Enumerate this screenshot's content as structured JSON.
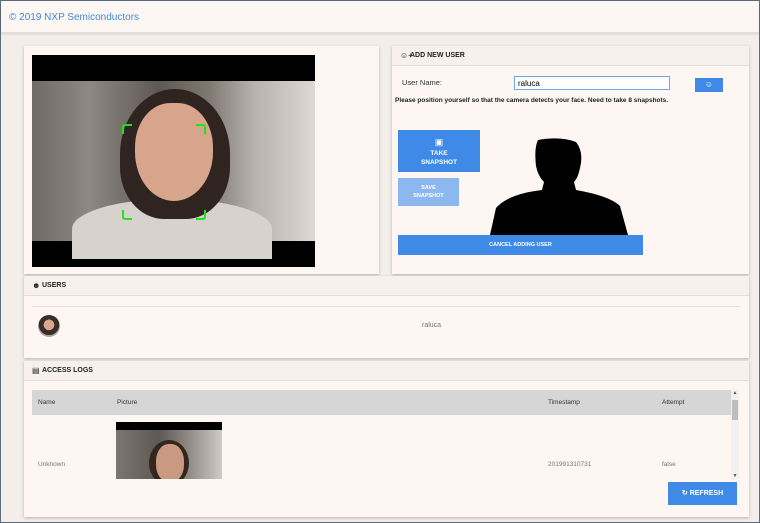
{
  "header": {
    "copyright": "© 2019 NXP Semiconductors"
  },
  "add_user": {
    "title": "ADD NEW USER",
    "username_label": "User Name:",
    "username_value": "raluca",
    "instruction": "Please position yourself so that the camera detects your face. Need to take 8 snapshots.",
    "take_snapshot": "TAKE SNAPSHOT",
    "save_snapshot": "SAVE SNAPSHOT",
    "cancel": "CANCEL ADDING USER"
  },
  "users": {
    "title": "USERS",
    "items": [
      {
        "name": "raluca"
      }
    ]
  },
  "access_logs": {
    "title": "ACCESS LOGS",
    "columns": [
      "Name",
      "Picture",
      "Timestamp",
      "Attempt"
    ],
    "rows": [
      {
        "name": "Unknown",
        "timestamp": "201991310731",
        "attempt": "false"
      }
    ],
    "refresh": "REFRESH"
  },
  "colors": {
    "accent": "#3f8ae6",
    "face_box": "#1ee21e"
  },
  "icons": {
    "add_user": "user-plus-icon",
    "users": "user-icon",
    "logs": "id-card-icon",
    "take": "camera-icon",
    "add_face": "user-add-icon",
    "refresh": "refresh-icon"
  }
}
